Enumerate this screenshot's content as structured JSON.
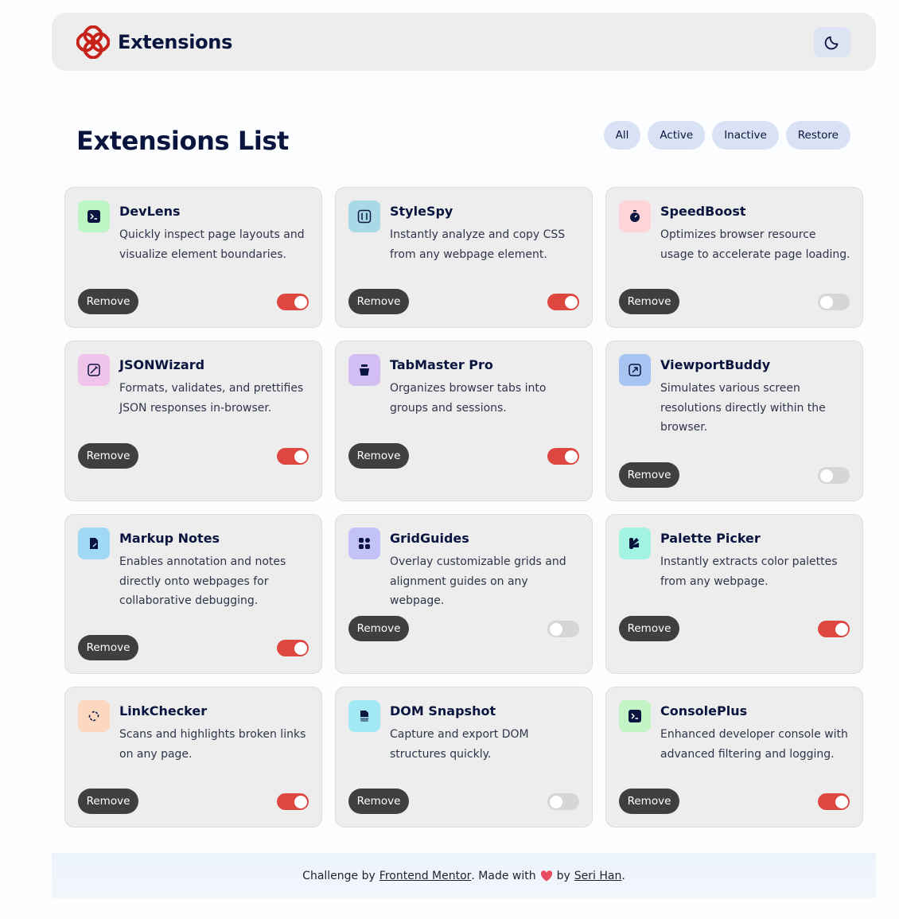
{
  "header": {
    "title": "Extensions",
    "logo_icon": "flower-logo-icon",
    "theme_icon": "moon-icon",
    "accent": "#c7221a"
  },
  "main": {
    "title": "Extensions List",
    "filters": [
      {
        "label": "All"
      },
      {
        "label": "Active"
      },
      {
        "label": "Inactive"
      },
      {
        "label": "Restore"
      }
    ]
  },
  "extensions": [
    {
      "name": "DevLens",
      "description": "Quickly inspect page layouts and visualize element boundaries.",
      "remove_label": "Remove",
      "active": true,
      "icon": "terminal-icon",
      "icon_bg": "#bdf5c4"
    },
    {
      "name": "StyleSpy",
      "description": "Instantly analyze and copy CSS from any webpage element.",
      "remove_label": "Remove",
      "active": true,
      "icon": "brackets-icon",
      "icon_bg": "#a9d8e6"
    },
    {
      "name": "SpeedBoost",
      "description": "Optimizes browser resource usage to accelerate page loading.",
      "remove_label": "Remove",
      "active": false,
      "icon": "stopwatch-icon",
      "icon_bg": "#fdd4d8"
    },
    {
      "name": "JSONWizard",
      "description": "Formats, validates, and prettifies JSON responses in-browser.",
      "remove_label": "Remove",
      "active": true,
      "icon": "wand-icon",
      "icon_bg": "#f0c3ea"
    },
    {
      "name": "TabMaster Pro",
      "description": "Organizes browser tabs into groups and sessions.",
      "remove_label": "Remove",
      "active": true,
      "icon": "jar-icon",
      "icon_bg": "#d3bef3"
    },
    {
      "name": "ViewportBuddy",
      "description": "Simulates various screen resolutions directly within the browser.",
      "remove_label": "Remove",
      "active": false,
      "icon": "resize-icon",
      "icon_bg": "#a8c4f2"
    },
    {
      "name": "Markup Notes",
      "description": "Enables annotation and notes directly onto webpages for collaborative debugging.",
      "remove_label": "Remove",
      "active": true,
      "icon": "note-pen-icon",
      "icon_bg": "#9fd9f3"
    },
    {
      "name": "GridGuides",
      "description": "Overlay customizable grids and alignment guides on any webpage.",
      "remove_label": "Remove",
      "active": false,
      "icon": "grid-icon",
      "icon_bg": "#c2c2f8"
    },
    {
      "name": "Palette Picker",
      "description": "Instantly extracts color palettes from any webpage.",
      "remove_label": "Remove",
      "active": true,
      "icon": "palette-icon",
      "icon_bg": "#a3f3e2"
    },
    {
      "name": "LinkChecker",
      "description": "Scans and highlights broken links on any page.",
      "remove_label": "Remove",
      "active": true,
      "icon": "broken-link-icon",
      "icon_bg": "#fdd8c1"
    },
    {
      "name": "DOM Snapshot",
      "description": "Capture and export DOM structures quickly.",
      "remove_label": "Remove",
      "active": false,
      "icon": "snapshot-icon",
      "icon_bg": "#a3e9f5"
    },
    {
      "name": "ConsolePlus",
      "description": "Enhanced developer console with advanced filtering and logging.",
      "remove_label": "Remove",
      "active": true,
      "icon": "console-icon",
      "icon_bg": "#c2f4c6"
    }
  ],
  "footer": {
    "prefix": "Challenge by",
    "link1": "Frontend Mentor",
    "middle": ". Made with",
    "heart_icon": "heart-icon",
    "by": "by",
    "link2": "Seri Han",
    "suffix": "."
  },
  "colors": {
    "toggle_on": "#de473f",
    "toggle_off": "#d6d6d6",
    "remove_bg": "#3f3f3f"
  }
}
